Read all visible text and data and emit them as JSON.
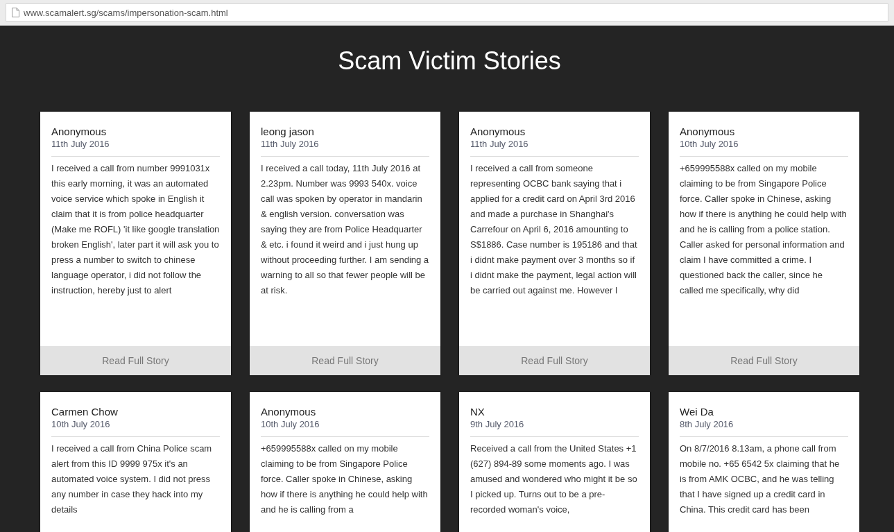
{
  "address_bar": {
    "url": "www.scamalert.sg/scams/impersonation-scam.html"
  },
  "page_title": "Scam Victim Stories",
  "stories": [
    {
      "author": "Anonymous",
      "date": "11th July 2016",
      "text": "I received a call from number 9991031x this early morning, it was an automated voice service which spoke in English it claim that it is from police headquarter (Make me ROFL) 'it like google translation broken English', later part it will ask you to press a number to switch to chinese language operator, i did not follow the instruction, hereby just to alert",
      "button": "Read Full Story"
    },
    {
      "author": "leong jason",
      "date": "11th July 2016",
      "text": "I received a call today, 11th July 2016 at 2.23pm. Number was 9993 540x. voice call was spoken by operator in mandarin & english version. conversation was saying they are from Police Headquarter & etc. i found it weird and i just hung up without proceeding further. I am sending a warning to all so that fewer people will be at risk.",
      "button": "Read Full Story"
    },
    {
      "author": "Anonymous",
      "date": "11th July 2016",
      "text": "I received a call from someone representing OCBC bank saying that i applied for a credit card on April 3rd 2016 and made a purchase in Shanghai's Carrefour on April 6, 2016 amounting to S$1886. Case number is 195186 and that i didnt make payment over 3 months so if i didnt make the payment, legal action will be carried out against me. However I",
      "button": "Read Full Story"
    },
    {
      "author": "Anonymous",
      "date": "10th July 2016",
      "text": "+659995588x called on my mobile claiming to be from Singapore Police force. Caller spoke in Chinese, asking how if there is anything he could help with and he is calling from a police station. Caller asked for personal information and claim I have committed a crime. I questioned back the caller, since he called me specifically, why did",
      "button": "Read Full Story"
    },
    {
      "author": "Carmen Chow",
      "date": "10th July 2016",
      "text": "I received a call from China Police scam alert from this ID 9999 975x it's an automated voice system. I did not press any number in case they hack into my details"
    },
    {
      "author": "Anonymous",
      "date": "10th July 2016",
      "text": "+659995588x called on my mobile claiming to be from Singapore Police force. Caller spoke in Chinese, asking how if there is anything he could help with and he is calling from a"
    },
    {
      "author": "NX",
      "date": "9th July 2016",
      "text": "Received a call from the United States +1 (627) 894-89 some moments ago. I was amused and wondered who might it be so I picked up. Turns out to be a pre-recorded woman's voice,"
    },
    {
      "author": "Wei Da",
      "date": "8th July 2016",
      "text": "On 8/7/2016 8.13am, a phone call from mobile no. +65 6542 5x claiming that he is from AMK OCBC, and he was telling that I have signed up a credit card in China. This credit card has been"
    }
  ]
}
